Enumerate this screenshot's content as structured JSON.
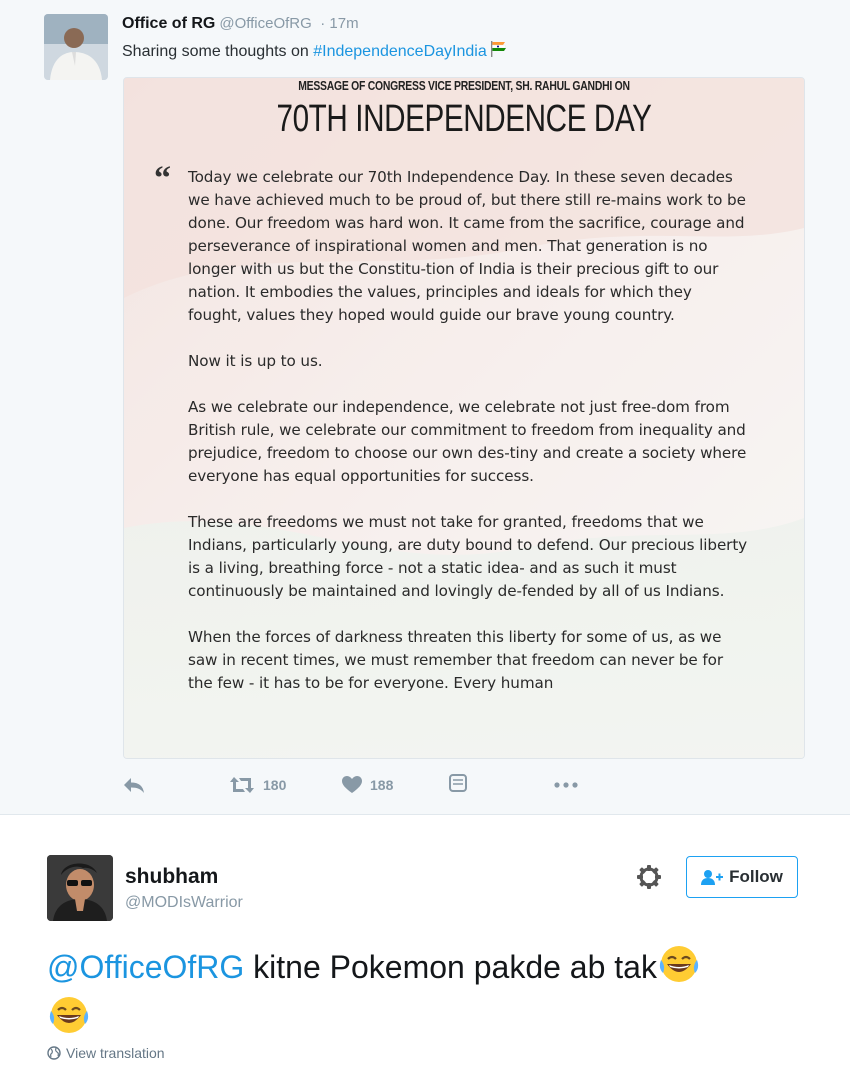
{
  "tweet": {
    "author_name": "Office of RG",
    "author_handle": "@OfficeOfRG",
    "time": "· 17m",
    "text_prefix": "Sharing some thoughts on ",
    "hashtag": "#IndependenceDayIndia",
    "image": {
      "subheading": "MESSAGE OF CONGRESS VICE PRESIDENT, SH. RAHUL GANDHI ON",
      "heading": "70TH INDEPENDENCE DAY",
      "paragraphs": [
        "Today we celebrate our 70th Independence Day. In these seven decades we have achieved much to be proud of, but there still re-mains work to be done. Our freedom was hard won. It came from the sacrifice, courage and perseverance of inspirational women and men. That generation is no longer with us but the Constitu-tion of India is their precious gift to our nation. It embodies the values, principles and ideals for which they fought, values they hoped would guide our brave young country.",
        "Now it is up to us.",
        "As we celebrate our independence, we celebrate not just free-dom from British rule, we celebrate our commitment to freedom from inequality and prejudice, freedom to choose our own des-tiny and create a society where everyone has equal opportunities for success.",
        "These are freedoms we must not take for granted, freedoms that we Indians, particularly young, are duty bound to defend. Our precious liberty is a living, breathing force - not a static idea- and as such it must continuously be maintained and lovingly de-fended by all of us Indians.",
        "When the forces of darkness threaten this liberty for some of us, as we saw in recent times, we must remember that freedom can never be for the few - it has to be for everyone. Every human"
      ]
    },
    "retweets": "180",
    "likes": "188"
  },
  "reply": {
    "author_name": "shubham",
    "author_handle": "@MODIsWarrior",
    "follow_label": "Follow",
    "mention": "@OfficeOfRG",
    "text": " kitne Pokemon pakde ab tak",
    "view_translation": "View translation"
  },
  "icons": {
    "reply": "reply-icon",
    "retweet": "retweet-icon",
    "like": "heart-icon",
    "dm": "message-icon",
    "more": "more-icon",
    "settings": "gear-icon",
    "follow": "add-user-icon",
    "globe": "globe-icon",
    "emoji": "laughing-emoji-icon"
  },
  "colors": {
    "link": "#1b95e0",
    "follow_border": "#1da1f2",
    "muted": "#8899a6"
  }
}
